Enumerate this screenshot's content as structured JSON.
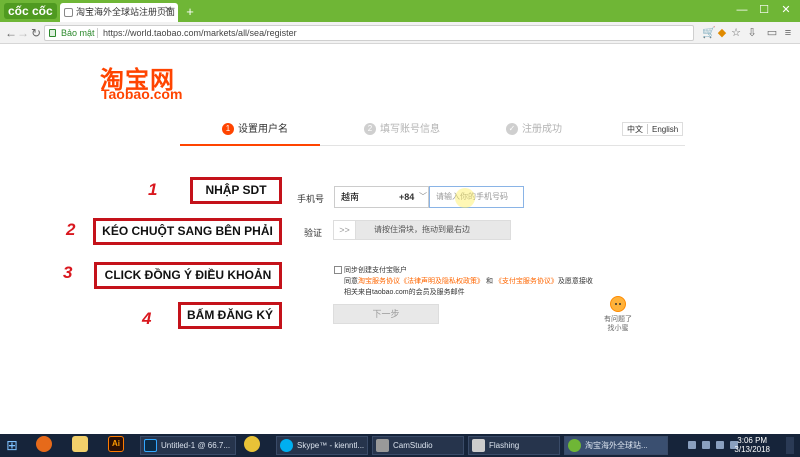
{
  "browser": {
    "brand": "cốc cốc",
    "tab_title": "淘宝海外全球站注册页面",
    "tab_close": "✕",
    "new_tab": "+",
    "window_buttons": [
      "—",
      "☐",
      "✕"
    ],
    "secure_label": "Bảo mật",
    "url": "https://world.taobao.com/markets/all/sea/register"
  },
  "page": {
    "logo_cn": "淘宝网",
    "logo_en": "Taobao.com",
    "language": [
      "中文",
      "English"
    ],
    "steps": [
      {
        "num": "1",
        "label": "设置用户名"
      },
      {
        "num": "2",
        "label": "填写账号信息"
      },
      {
        "num": "✓",
        "label": "注册成功"
      }
    ],
    "form": {
      "phone_label": "手机号",
      "country": "越南",
      "country_code": "+84",
      "phone_placeholder": "请输入你的手机号码",
      "verify_label": "验证",
      "slider_handle": ">>",
      "slider_text": "请按住滑块，拖动到最右边",
      "alipay_checkbox_label": "同步创建支付宝账户",
      "agree_prefix": "同意",
      "agree_link1": "淘宝服务协议",
      "agree_link2": "《法律声明及隐私权政策》",
      "agree_and": "和",
      "agree_link3": "《支付宝服务协议》",
      "agree_suffix": "及愿意接收",
      "agree_line2": "相关来自taobao.com的会员及服务邮件",
      "next_button": "下一步"
    },
    "helper": {
      "line1": "有问题了",
      "line2": "找小蜜"
    }
  },
  "annotations": [
    {
      "num": "1",
      "text": "NHẬP SDT"
    },
    {
      "num": "2",
      "text": "KÉO CHUỘT SANG BÊN PHẢI"
    },
    {
      "num": "3",
      "text": "CLICK ĐỒNG Ý ĐIỀU KHOẢN"
    },
    {
      "num": "4",
      "text": "BẤM ĐĂNG KÝ"
    }
  ],
  "taskbar": {
    "apps": [
      "Ai",
      "Untitled-1 @ 66.7...",
      "Skype™ - kienntl...",
      "CamStudio",
      "Flashing",
      "淘宝海外全球站..."
    ],
    "time": "3:06 PM",
    "date": "3/13/2018"
  },
  "colors": {
    "taobao_orange": "#ff4400",
    "annotation_red": "#c4121a",
    "coccoc_green": "#6fb636"
  }
}
